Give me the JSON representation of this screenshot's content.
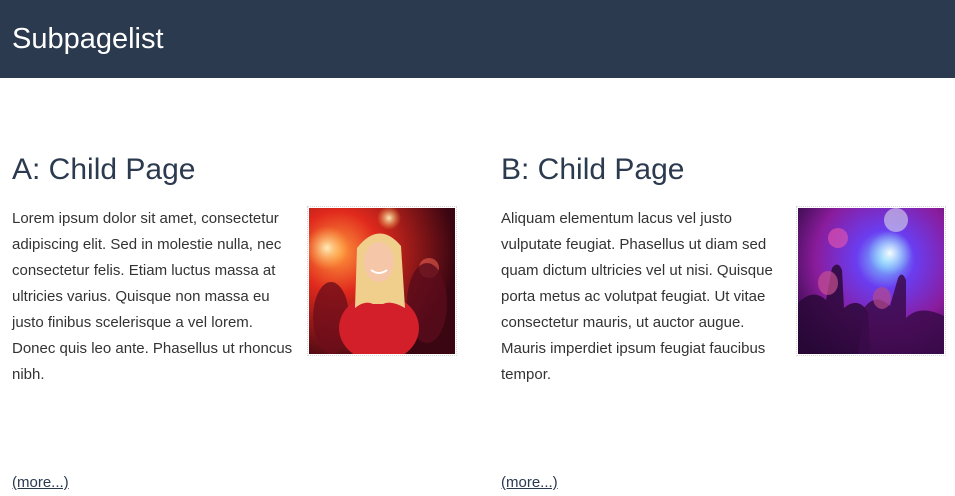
{
  "header": {
    "title": "Subpagelist"
  },
  "articles": [
    {
      "title": "A: Child Page",
      "excerpt": "Lorem ipsum dolor sit amet, consectetur adipiscing elit. Sed in molestie nulla, nec consectetur felis. Etiam luctus massa at ultricies varius. Quisque non massa eu justo finibus scelerisque a vel lorem. Donec quis leo ante. Phasellus ut rhoncus nibh.",
      "more_label": "(more...)",
      "image": "party-woman-red-photo"
    },
    {
      "title": "B: Child Page",
      "excerpt": "Aliquam elementum lacus vel justo vulputate feugiat. Phasellus ut diam sed quam dictum ultricies vel ut nisi. Quisque porta metus ac volutpat feugiat. Ut vitae consectetur mauris, ut auctor augue. Mauris imperdiet ipsum feugiat faucibus tempor.",
      "more_label": "(more...)",
      "image": "dance-crowd-purple-photo"
    }
  ],
  "colors": {
    "header_bg": "#2b3a4f",
    "header_text": "#ffffff",
    "heading": "#2b3a4f",
    "body_text": "#333333"
  }
}
